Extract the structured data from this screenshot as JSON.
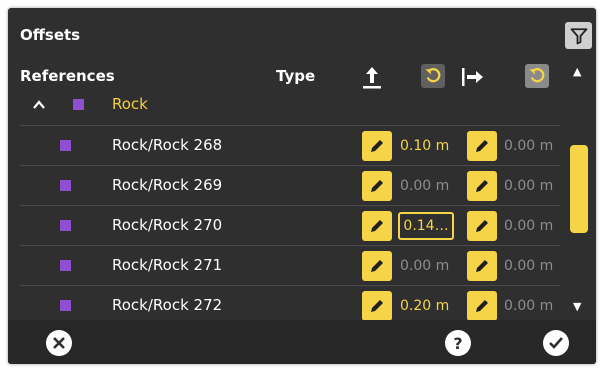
{
  "panel": {
    "title": "Offsets",
    "filter_icon": "filter-icon"
  },
  "header": {
    "references_label": "References",
    "type_label": "Type",
    "icons": [
      "up-arrow-icon",
      "undo-icon",
      "right-arrow-icon",
      "undo-icon"
    ]
  },
  "group": {
    "name": "Rock",
    "color": "#8e4fd0",
    "expanded": true
  },
  "rows": [
    {
      "name": "Rock/Rock 268",
      "offset1": "0.10 m",
      "offset1_active": true,
      "offset1_boxed": false,
      "offset2": "0.00 m"
    },
    {
      "name": "Rock/Rock 269",
      "offset1": "0.00 m",
      "offset1_active": false,
      "offset1_boxed": false,
      "offset2": "0.00 m"
    },
    {
      "name": "Rock/Rock 270",
      "offset1": "0.14…",
      "offset1_active": true,
      "offset1_boxed": true,
      "offset2": "0.00 m"
    },
    {
      "name": "Rock/Rock 271",
      "offset1": "0.00 m",
      "offset1_active": false,
      "offset1_boxed": false,
      "offset2": "0.00 m"
    },
    {
      "name": "Rock/Rock 272",
      "offset1": "0.20 m",
      "offset1_active": true,
      "offset1_boxed": false,
      "offset2": "0.00 m"
    }
  ],
  "scroll": {
    "up_glyph": "▲",
    "down_glyph": "▼"
  },
  "footer": {
    "cancel_icon": "close-icon",
    "help_label": "?",
    "confirm_icon": "checkmark-icon"
  },
  "colors": {
    "accent": "#f5d448",
    "background": "#2f2f2f",
    "inactive_text": "#8d8d8d"
  }
}
